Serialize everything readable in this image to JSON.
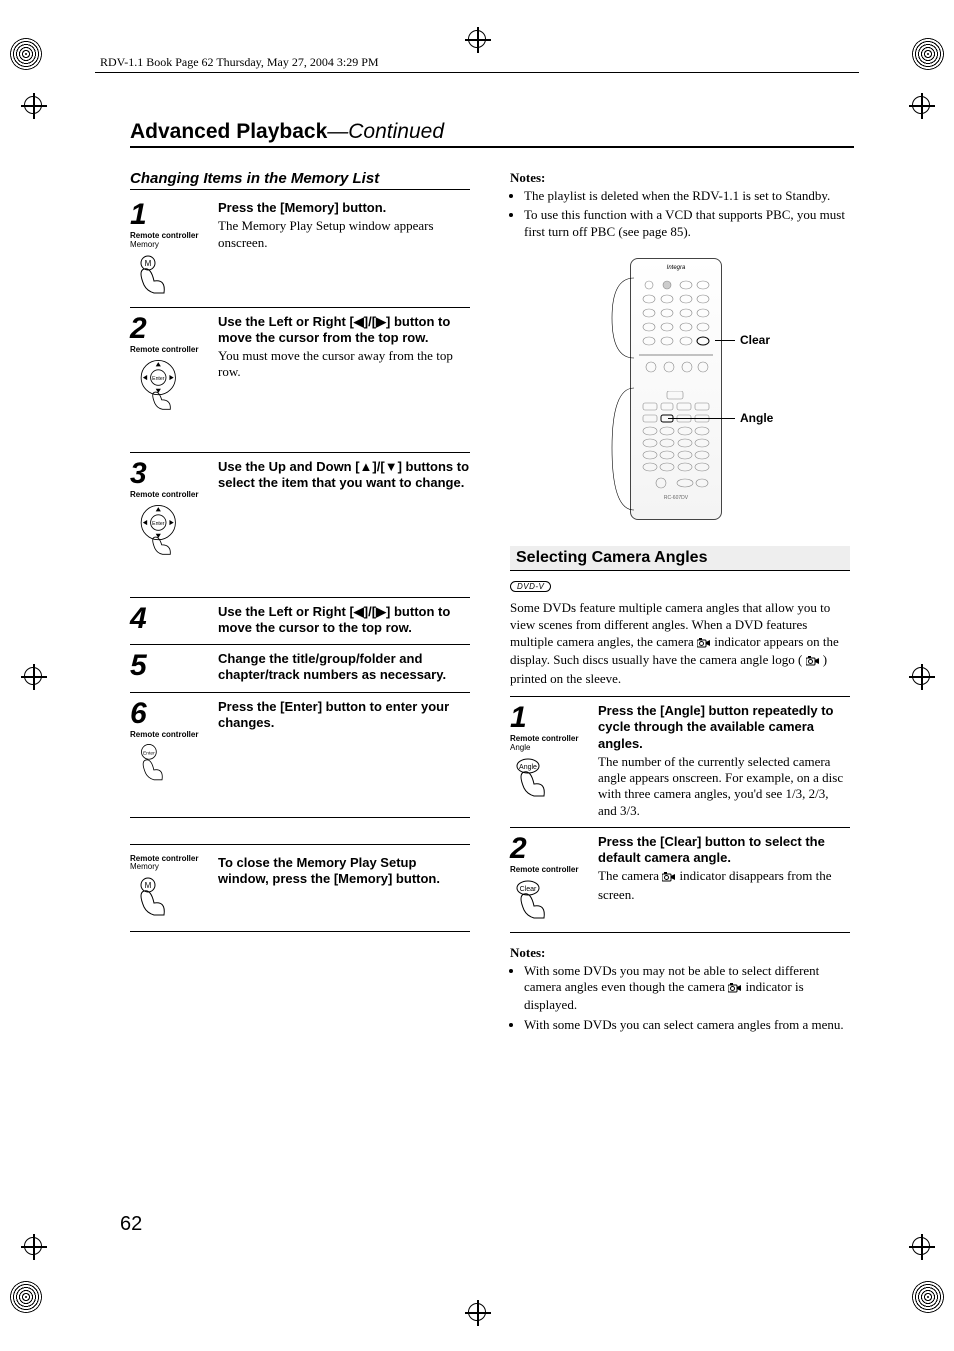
{
  "runner": "RDV-1.1 Book Page 62 Thursday, May 27, 2004 3:29 PM",
  "page_number": "62",
  "title_main": "Advanced Playback",
  "title_cont": "—Continued",
  "left": {
    "subhead": "Changing Items in the Memory List",
    "steps": [
      {
        "num": "1",
        "cap1": "Remote controller",
        "cap2": "Memory",
        "lead": "Press the [Memory] button.",
        "desc": "The Memory Play Setup window appears onscreen."
      },
      {
        "num": "2",
        "cap1": "Remote controller",
        "cap2": "",
        "lead": "Use the Left or Right [◀]/[▶] button to move the cursor from the top row.",
        "desc": "You must move the cursor away from the top row."
      },
      {
        "num": "3",
        "cap1": "Remote controller",
        "cap2": "",
        "lead": "Use the Up and Down [▲]/[▼] buttons to select the item that you want to change.",
        "desc": ""
      },
      {
        "num": "4",
        "cap1": "",
        "cap2": "",
        "lead": "Use the Left or Right [◀]/[▶] button to move the cursor to the top row.",
        "desc": ""
      },
      {
        "num": "5",
        "cap1": "",
        "cap2": "",
        "lead": "Change the title/group/folder and chapter/track numbers as necessary.",
        "desc": ""
      },
      {
        "num": "6",
        "cap1": "Remote controller",
        "cap2": "",
        "lead": "Press the [Enter] button to enter your changes.",
        "desc": ""
      }
    ],
    "closing_cap1": "Remote controller",
    "closing_cap2": "Memory",
    "closing_lead": "To close the Memory Play Setup window, press the [Memory] button."
  },
  "right": {
    "notes_head": "Notes:",
    "notes": [
      "The playlist is deleted when the RDV-1.1 is set to Standby.",
      "To use this function with a VCD that supports PBC, you must first turn off PBC (see page 85)."
    ],
    "remote_labels": {
      "clear": "Clear",
      "angle": "Angle",
      "model": "RC-607DV",
      "brand": "Integra"
    },
    "section2_head": "Selecting Camera Angles",
    "dvdv_badge": "DVD-V",
    "intro_a": "Some DVDs feature multiple camera angles that allow you to view scenes from different angles. When a DVD features multiple camera angles, the camera ",
    "intro_b": " indicator appears on the display. Such discs usually have the camera angle logo (",
    "intro_c": ") printed on the sleeve.",
    "steps": [
      {
        "num": "1",
        "cap1": "Remote controller",
        "cap2": "Angle",
        "lead": "Press the [Angle] button repeatedly to cycle through the available camera angles.",
        "desc": "The number of the currently selected camera angle appears onscreen. For example, on a disc with three camera angles, you'd see 1/3, 2/3, and 3/3."
      },
      {
        "num": "2",
        "cap1": "Remote controller",
        "cap2": "Clear",
        "lead": "Press the [Clear] button to select the default camera angle.",
        "desc_a": "The camera ",
        "desc_b": " indicator disappears from the screen."
      }
    ],
    "notes2_head": "Notes:",
    "notes2_a": "With some DVDs you may not be able to select different camera angles even though the camera ",
    "notes2_b": " indicator is displayed.",
    "notes2_item2": "With some DVDs you can select camera angles from a menu."
  }
}
